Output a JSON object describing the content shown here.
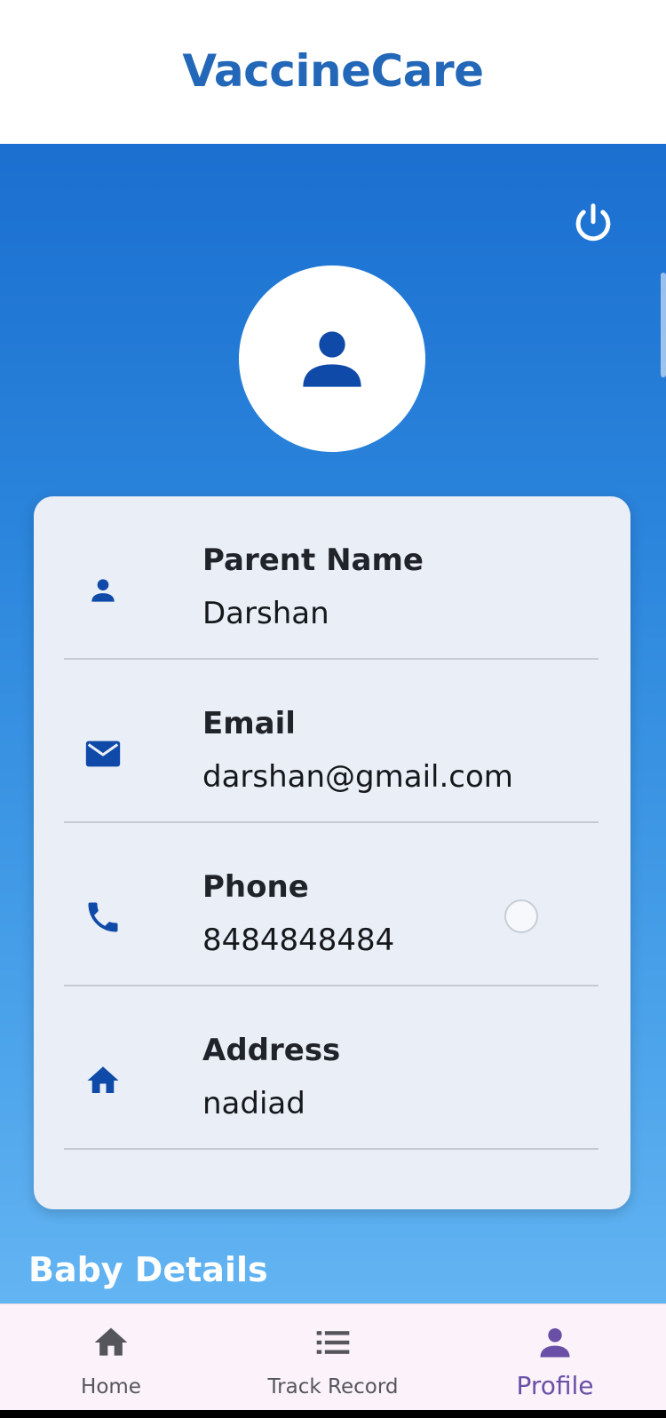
{
  "app_bar": {
    "title": "VaccineCare"
  },
  "profile": {
    "fields": [
      {
        "label": "Parent Name",
        "value": "Darshan",
        "icon": "person-icon"
      },
      {
        "label": "Email",
        "value": "darshan@gmail.com",
        "icon": "email-icon"
      },
      {
        "label": "Phone",
        "value": "8484848484",
        "icon": "phone-icon"
      },
      {
        "label": "Address",
        "value": "nadiad",
        "icon": "home-icon"
      }
    ],
    "next_section_heading": "Baby Details"
  },
  "bottom_nav": {
    "items": [
      {
        "label": "Home",
        "icon": "home-icon"
      },
      {
        "label": "Track Record",
        "icon": "list-icon"
      },
      {
        "label": "Profile",
        "icon": "person-icon",
        "active": true
      }
    ]
  },
  "colors": {
    "brand": "#2367b8",
    "icon_blue": "#0f4aa8",
    "nav_active": "#6a4fa6",
    "nav_inactive": "#55565c"
  }
}
